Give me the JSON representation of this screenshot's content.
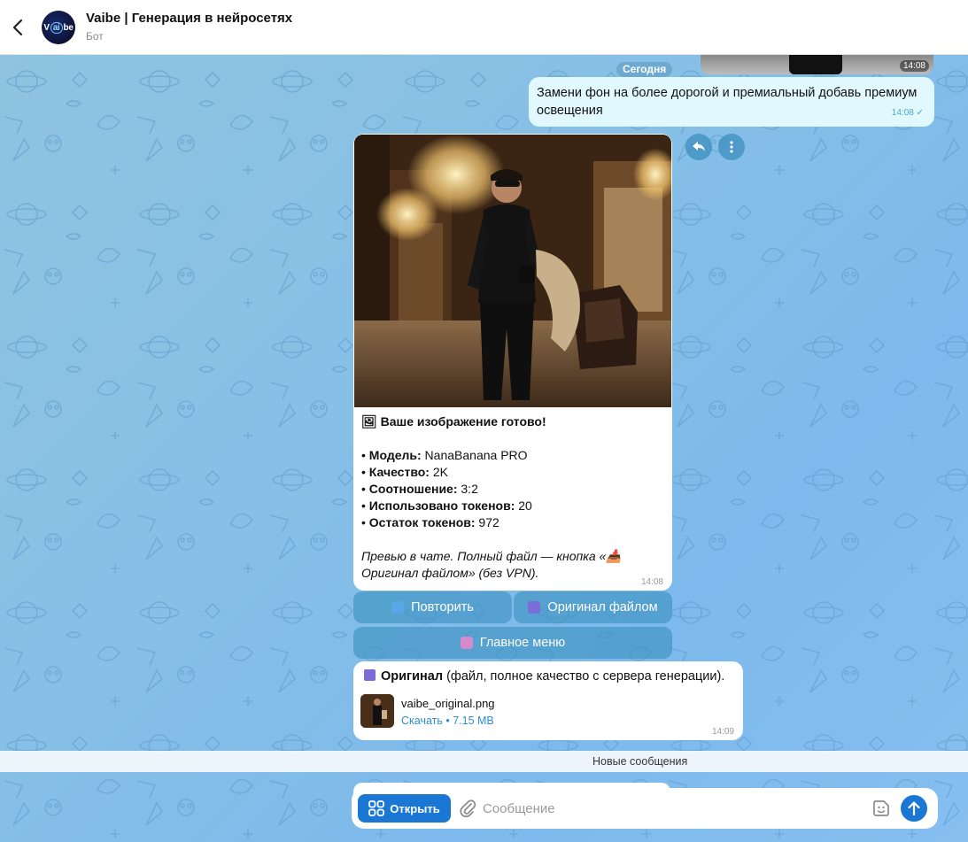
{
  "header": {
    "title": "Vaibe | Генерация в нейросетях",
    "subtitle": "Бот",
    "avatar_text_left": "V",
    "avatar_text_ring": "ai",
    "avatar_text_right": "be"
  },
  "chat": {
    "date_separator": "Сегодня",
    "previous_image_time": "14:08",
    "outgoing_message": {
      "text": "Замени фон на более дорогой и премиальный добавь премиум освещения",
      "time": "14:08"
    },
    "bot_message": {
      "heading": "🖼 Ваше изображение готово!",
      "model_label": "Модель:",
      "model_value": " NanaBanana PRO",
      "quality_label": "Качество:",
      "quality_value": " 2K",
      "ratio_label": "Соотношение:",
      "ratio_value": " 3:2",
      "tokens_used_label": "Использовано токенов:",
      "tokens_used_value": " 20",
      "tokens_left_label": "Остаток токенов:",
      "tokens_left_value": " 972",
      "note": "Превью в чате. Полный файл — кнопка «📥 Оригинал файлом» (без VPN).",
      "time": "14:08"
    },
    "buttons": {
      "repeat": "Повторить",
      "original_file": "Оригинал файлом",
      "main_menu": "Главное меню"
    },
    "file_message": {
      "title_bold": "Оригинал",
      "title_rest": " (файл, полное качество с сервера генерации).",
      "file_name": "vaibe_original.png",
      "file_meta": "Скачать • 7.15 MB",
      "time": "14:09"
    },
    "new_messages_banner": "Новые сообщения"
  },
  "composer": {
    "open_button": "Открыть",
    "placeholder": "Сообщение"
  },
  "colors": {
    "accent": "#1a78d4",
    "outgoing_bubble": "#e2f8ff",
    "inline_button": "#3c91be"
  }
}
